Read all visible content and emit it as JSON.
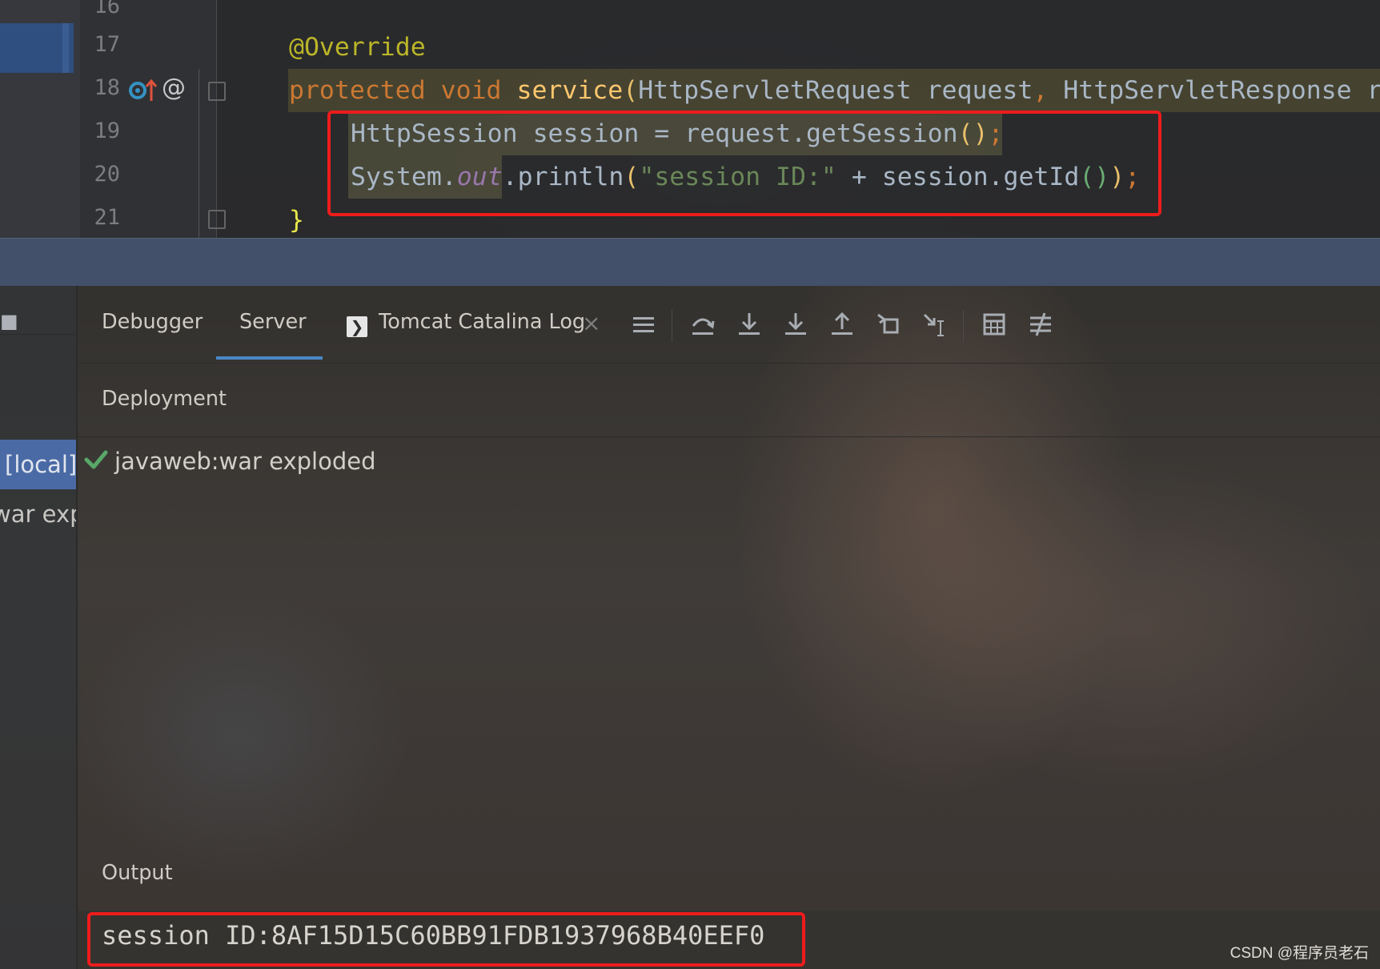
{
  "editor": {
    "line_numbers": [
      "16",
      "17",
      "18",
      "19",
      "20",
      "21"
    ],
    "lines": {
      "l17": {
        "annotation": "@Override"
      },
      "l18": {
        "kw_protected": "protected",
        "kw_void": "void",
        "method": "service",
        "open_paren": "(",
        "param1_type": "HttpServletRequest",
        "param1_name": "request",
        "comma": ",",
        "param2_type": "HttpServletResponse",
        "param2_name_partial": "r"
      },
      "l19": {
        "type": "HttpSession",
        "rest": " session = request.getSession",
        "parens": "()",
        "semi": ";"
      },
      "l20": {
        "system": "System.",
        "out": "out",
        "println": ".println",
        "open": "(",
        "string": "\"session ID:\"",
        "plus": " + session.getId",
        "inner_parens": "()",
        "close": ")",
        "semi": ";"
      },
      "l21": {
        "brace": "}"
      }
    }
  },
  "services": {
    "left_panel": {
      "selected_item": "[local]",
      "item2": "war expl"
    },
    "tabs": {
      "debugger": "Debugger",
      "server": "Server",
      "tomcat_log": "Tomcat Catalina Log",
      "close": "×"
    },
    "toolbar_icons": [
      "menu-icon",
      "step-over-icon",
      "step-into-icon",
      "force-step-into-icon",
      "step-out-icon",
      "drop-frame-icon",
      "run-to-cursor-icon",
      "evaluate-expression-icon",
      "trace-icon"
    ],
    "deployment": {
      "title": "Deployment",
      "artifact": "javaweb:war exploded",
      "status_color": "#59a869"
    },
    "output": {
      "title": "Output",
      "text": "session ID:8AF15D15C60BB91FDB1937968B40EEF0"
    }
  },
  "watermark": "CSDN @程序员老石",
  "colors": {
    "highlight_border": "#ee1c1c",
    "selected_tab_underline": "#4a88c7"
  }
}
